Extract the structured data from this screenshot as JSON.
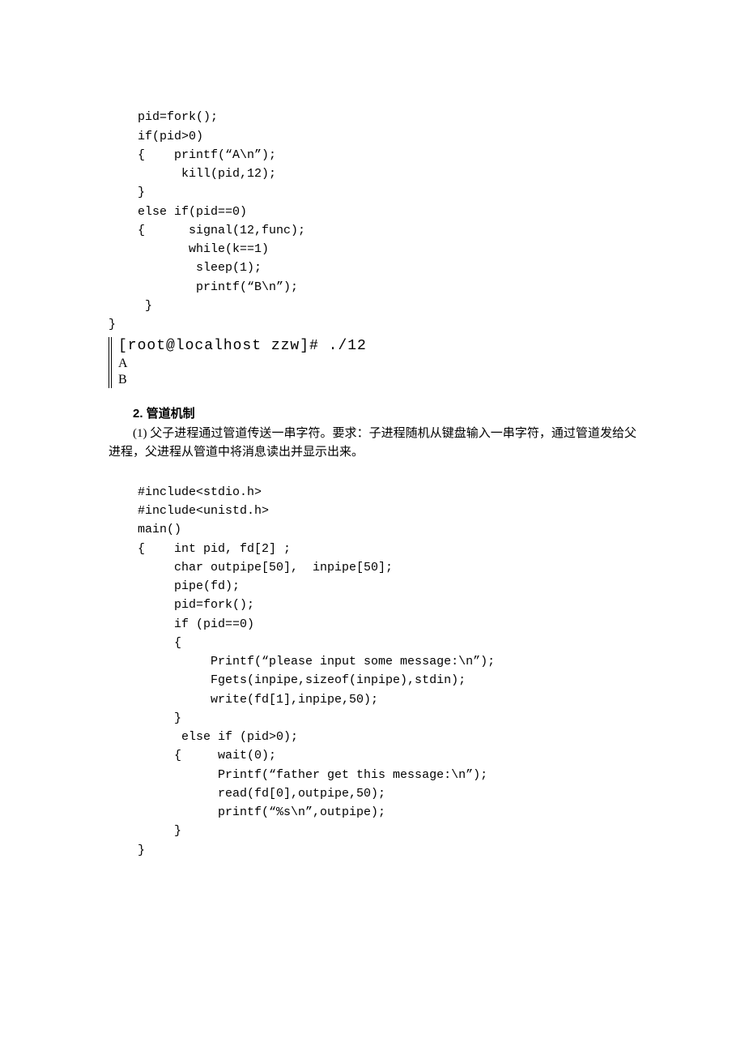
{
  "codeBlock1": {
    "l1": "    pid=fork();",
    "l2": "    if(pid>0)",
    "l3": "    {    printf(“A\\n”);",
    "l4": "          kill(pid,12);",
    "l5": "    }",
    "l6": "    else if(pid==0)",
    "l7": "    {      signal(12,func);",
    "l8": "           while(k==1)",
    "l9": "            sleep(1);",
    "l10": "            printf(“B\\n”);",
    "l11": "     }",
    "l12": "}"
  },
  "terminal": {
    "line1": "[root@localhost zzw]# ./12",
    "line2": "A",
    "line3": "B"
  },
  "heading2": "2. 管道机制",
  "desc2": "(1) 父子进程通过管道传送一串字符。要求：子进程随机从键盘输入一串字符，通过管道发给父进程，父进程从管道中将消息读出并显示出来。",
  "codeBlock2": {
    "l1": "    #include<stdio.h>",
    "l2": "    #include<unistd.h>",
    "l3": "    main()",
    "l4": "    {    int pid, fd[2] ;",
    "l5": "         char outpipe[50],  inpipe[50];",
    "l6": "         pipe(fd);",
    "l7": "         pid=fork();",
    "l8": "         if (pid==0)",
    "l9": "         {",
    "l10": "              Printf(“please input some message:\\n”);",
    "l11": "              Fgets(inpipe,sizeof(inpipe),stdin);",
    "l12": "              write(fd[1],inpipe,50);",
    "l13": "         }",
    "l14": "          else if (pid>0);",
    "l15": "         {     wait(0);",
    "l16": "               Printf(“father get this message:\\n”);",
    "l17": "               read(fd[0],outpipe,50);",
    "l18": "               printf(“%s\\n”,outpipe);",
    "l19": "         }",
    "l20": "    }"
  }
}
